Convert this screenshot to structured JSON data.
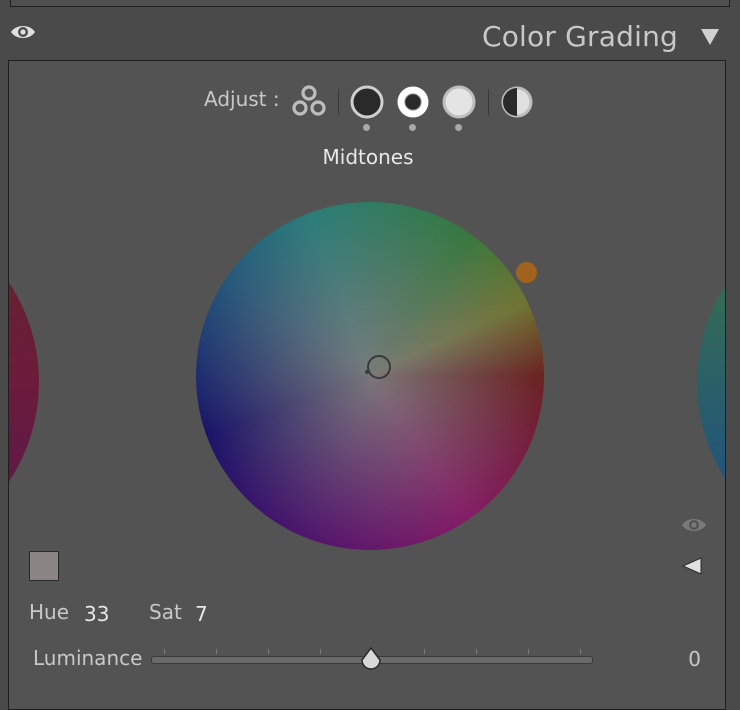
{
  "panel": {
    "title": "Color Grading"
  },
  "adjust": {
    "label": "Adjust :",
    "buttons": [
      {
        "name": "three-way",
        "icon": "three-circles-icon"
      },
      {
        "name": "shadows",
        "icon": "shadows-circle-icon"
      },
      {
        "name": "midtones",
        "icon": "midtones-circle-icon",
        "selected": true
      },
      {
        "name": "highlights",
        "icon": "highlights-circle-icon"
      },
      {
        "name": "global",
        "icon": "half-circle-icon"
      }
    ]
  },
  "region": {
    "label": "Midtones"
  },
  "wheel": {
    "hue": 33,
    "saturation": 7,
    "handle_color": "#a0621c"
  },
  "fields": {
    "hue_label": "Hue",
    "hue_value": "33",
    "sat_label": "Sat",
    "sat_value": "7"
  },
  "luminance": {
    "label": "Luminance",
    "value": "0",
    "slider_fraction": 0.5
  },
  "swatch": {
    "color": "#8a8482"
  }
}
